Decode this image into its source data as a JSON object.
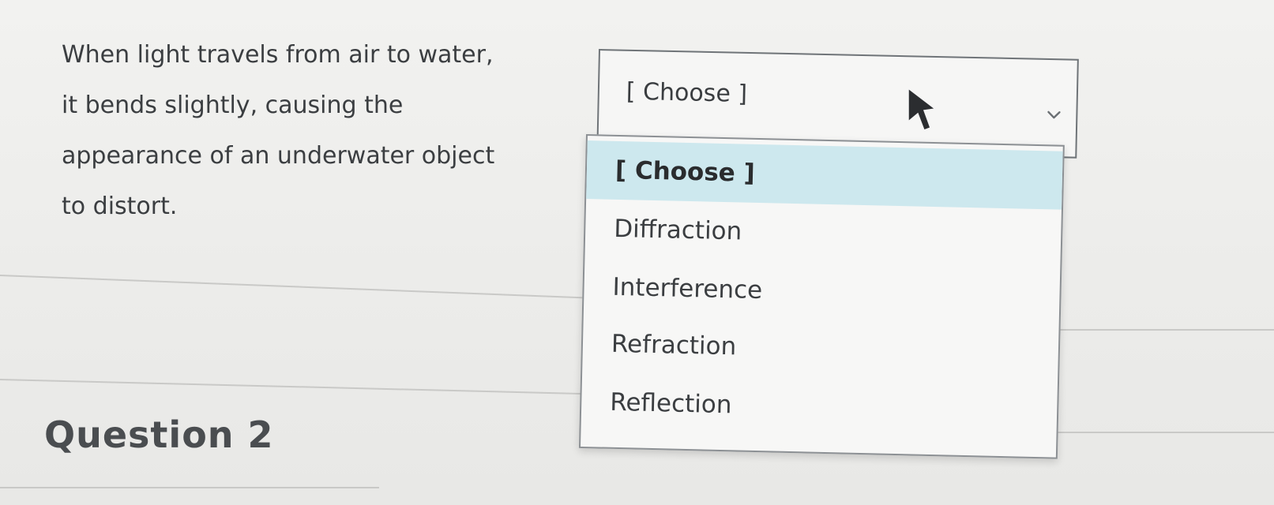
{
  "question1": {
    "text_lines": [
      "When light travels from air to water,",
      "it bends slightly, causing the",
      "appearance of an underwater object",
      "to distort."
    ],
    "dropdown": {
      "selected_value": "[ Choose ]",
      "options": [
        "[ Choose ]",
        "Diffraction",
        "Interference",
        "Refraction",
        "Reflection"
      ],
      "highlighted_option": "[ Choose ]",
      "highlight_color": "#cde8ee"
    }
  },
  "question2": {
    "heading": "Question 2"
  },
  "icons": {
    "dropdown_arrow": "chevron-down-icon",
    "pointer": "mouse-cursor-icon"
  }
}
